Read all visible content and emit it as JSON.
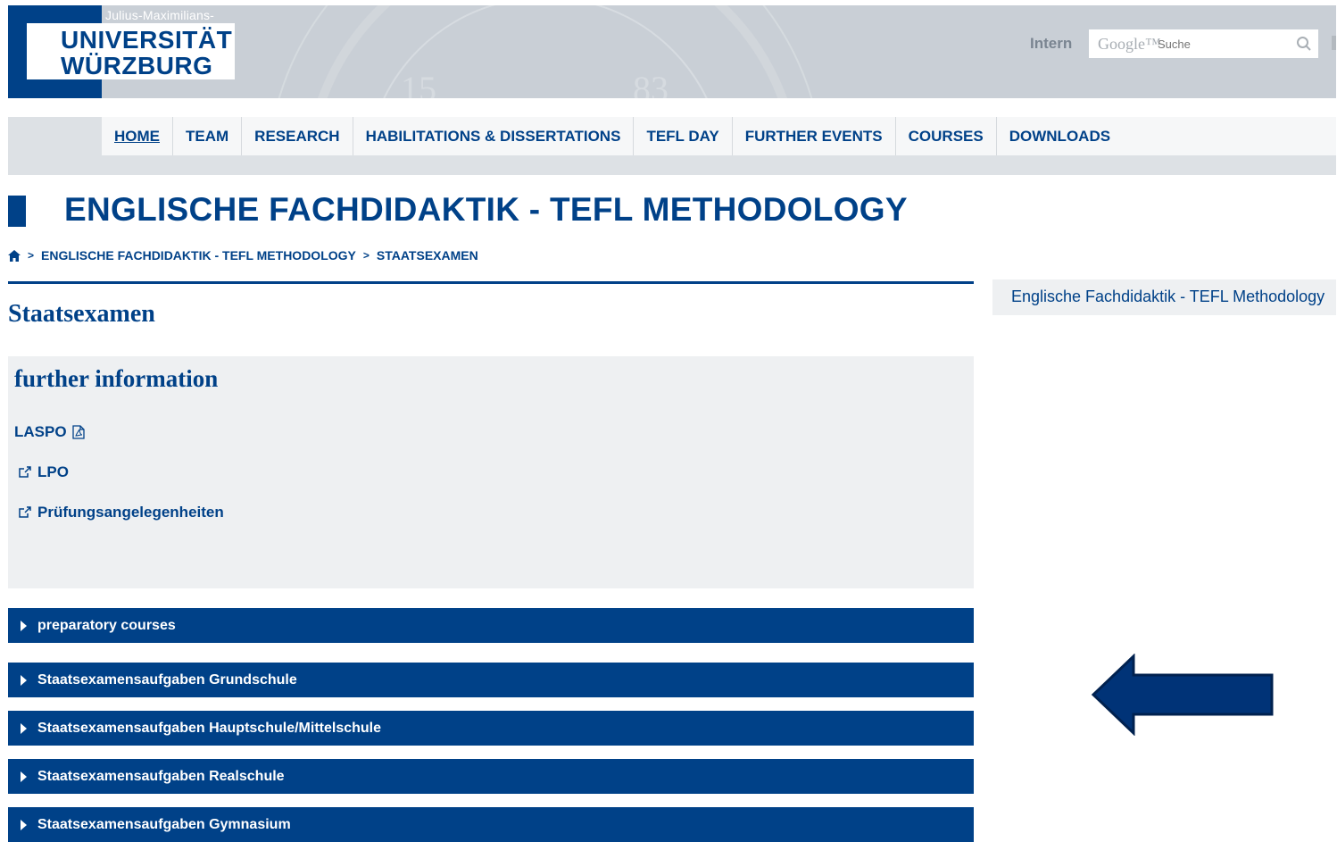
{
  "header": {
    "logo": {
      "line_top": "Julius-Maximilians-",
      "line1": "UNIVERSITÄT",
      "line2": "WÜRZBURG"
    },
    "seal_text": {
      "left": "15",
      "right": "83"
    },
    "intern_label": "Intern",
    "search": {
      "brand": "Google™",
      "placeholder": "Suche"
    }
  },
  "nav": {
    "items": [
      {
        "label": "HOME",
        "active": true
      },
      {
        "label": "TEAM"
      },
      {
        "label": "RESEARCH"
      },
      {
        "label": "HABILITATIONS & DISSERTATIONS"
      },
      {
        "label": "TEFL DAY"
      },
      {
        "label": "FURTHER EVENTS"
      },
      {
        "label": "COURSES"
      },
      {
        "label": "DOWNLOADS"
      }
    ]
  },
  "page": {
    "title": "ENGLISCHE FACHDIDAKTIK - TEFL METHODOLOGY",
    "breadcrumb": {
      "sep": ">",
      "item1": "ENGLISCHE FACHDIDAKTIK - TEFL METHODOLOGY",
      "item2": "STAATSEXAMEN"
    },
    "heading": "Staatsexamen"
  },
  "info": {
    "title": "further information",
    "links": [
      "LASPO",
      "LPO",
      "Prüfungsangelegenheiten"
    ]
  },
  "accordions": [
    "preparatory courses",
    "Staatsexamensaufgaben Grundschule",
    "Staatsexamensaufgaben Hauptschule/Mittelschule",
    "Staatsexamensaufgaben Realschule",
    "Staatsexamensaufgaben Gymnasium"
  ],
  "sidebar": {
    "link": "Englische Fachdidaktik - TEFL Methodology"
  },
  "colors": {
    "primary": "#004188",
    "arrow": "#003377",
    "header_bg": "#c9cfd6",
    "panel_bg": "#eef0f2"
  }
}
